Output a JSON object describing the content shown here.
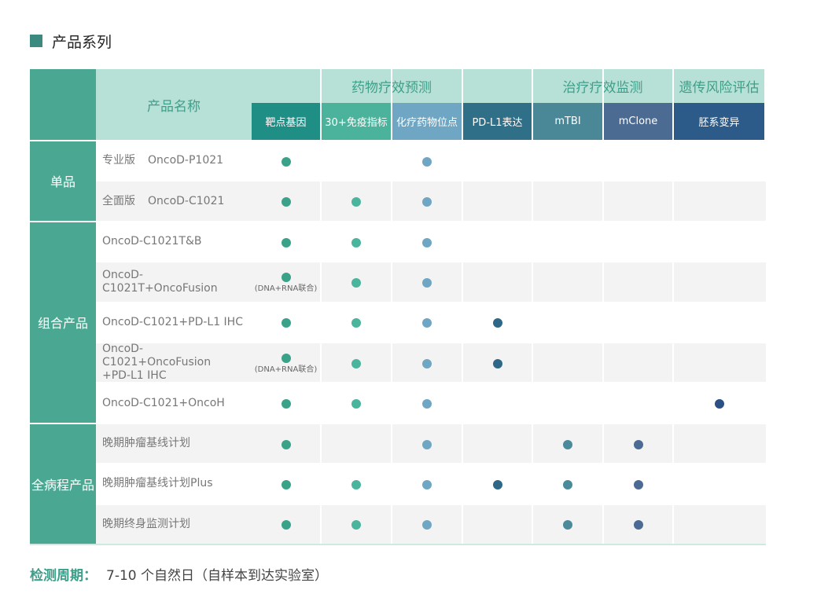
{
  "section": {
    "title": "产品系列"
  },
  "table": {
    "name_header": "产品名称",
    "super_headers": [
      {
        "label": "药物疗效预测",
        "span": [
          0,
          3
        ]
      },
      {
        "label": "治疗疗效监测",
        "span": [
          4,
          5
        ]
      },
      {
        "label": "遗传风险评估",
        "span": [
          6,
          6
        ]
      }
    ],
    "sub_headers": [
      {
        "label": "靶点基因",
        "color": "#1f8f86"
      },
      {
        "label": "30+免疫指标",
        "color": "#4bb39b"
      },
      {
        "label": "化疗药物位点",
        "color": "#6fa6c3"
      },
      {
        "label": "PD-L1表达",
        "color": "#2f6f88"
      },
      {
        "label": "mTBI",
        "color": "#4a8898"
      },
      {
        "label": "mClone",
        "color": "#4c6b92"
      },
      {
        "label": "胚系变异",
        "color": "#2c5a89"
      }
    ],
    "groups": [
      {
        "label": "单品",
        "rows": [
          0,
          1
        ]
      },
      {
        "label": "组合产品",
        "rows": [
          2,
          6
        ]
      },
      {
        "label": "全病程产品",
        "rows": [
          7,
          9
        ]
      }
    ],
    "rows": [
      {
        "version": "专业版",
        "name": "OncoD-P1021",
        "dots": [
          0,
          2
        ],
        "notes": {}
      },
      {
        "version": "全面版",
        "name": "OncoD-C1021",
        "dots": [
          0,
          1,
          2
        ],
        "notes": {}
      },
      {
        "version": "",
        "name": "OncoD-C1021T&B",
        "dots": [
          0,
          1,
          2
        ],
        "notes": {}
      },
      {
        "version": "",
        "name": "OncoD-C1021T+OncoFusion",
        "dots": [
          0,
          1,
          2
        ],
        "notes": {
          "0": "(DNA+RNA联合)"
        }
      },
      {
        "version": "",
        "name": "OncoD-C1021+PD-L1 IHC",
        "dots": [
          0,
          1,
          2,
          3
        ],
        "notes": {}
      },
      {
        "version": "",
        "name": "OncoD-C1021+OncoFusion\n+PD-L1 IHC",
        "dots": [
          0,
          1,
          2,
          3
        ],
        "notes": {
          "0": "(DNA+RNA联合)"
        }
      },
      {
        "version": "",
        "name": "OncoD-C1021+OncoH",
        "dots": [
          0,
          1,
          2,
          6
        ],
        "notes": {}
      },
      {
        "version": "",
        "name": "晚期肿瘤基线计划",
        "dots": [
          0,
          2,
          4,
          5
        ],
        "notes": {}
      },
      {
        "version": "",
        "name": "晚期肿瘤基线计划Plus",
        "dots": [
          0,
          1,
          2,
          3,
          4,
          5
        ],
        "notes": {}
      },
      {
        "version": "",
        "name": "晚期终身监测计划",
        "dots": [
          0,
          1,
          2,
          4,
          5
        ],
        "notes": {}
      }
    ],
    "dot_colors": [
      "#3aa288",
      "#4bb49c",
      "#6fa6c3",
      "#2e6886",
      "#4b8a9a",
      "#4c6b94",
      "#2c4f86"
    ]
  },
  "footer": {
    "label": "检测周期：",
    "value": "7-10 个自然日（自样本到达实验室）"
  }
}
